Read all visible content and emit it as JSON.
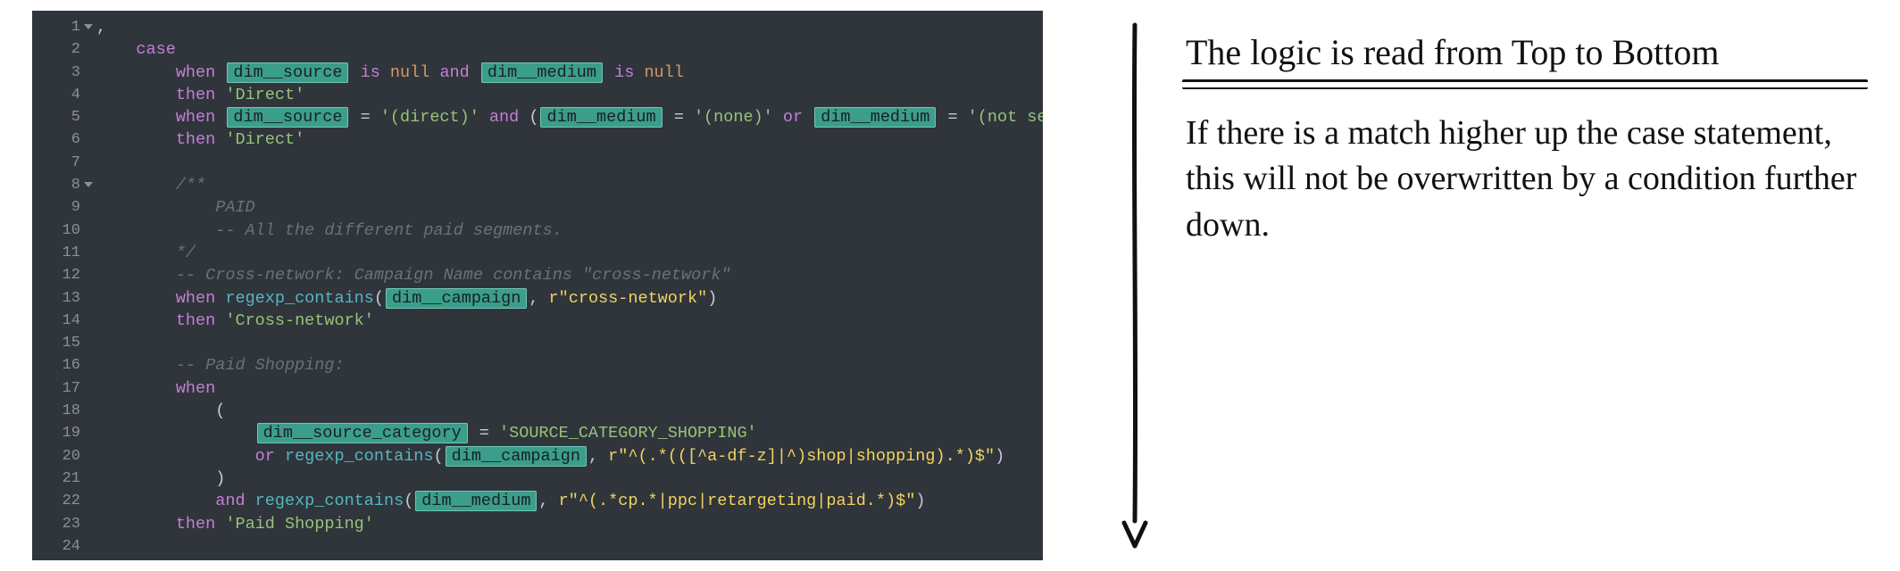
{
  "annotation": {
    "heading": "The logic is read from Top to Bottom",
    "body": "If there is a match higher up the case statement, this will not be overwritten by a condition further down."
  },
  "code": {
    "lines": [
      {
        "n": 1,
        "fold": true,
        "indent": 0,
        "tokens": [
          {
            "t": ",",
            "c": "punc"
          }
        ]
      },
      {
        "n": 2,
        "fold": false,
        "indent": 4,
        "tokens": [
          {
            "t": "case",
            "c": "kw"
          }
        ]
      },
      {
        "n": 3,
        "fold": false,
        "indent": 8,
        "tokens": [
          {
            "t": "when",
            "c": "kw"
          },
          {
            "t": " "
          },
          {
            "t": "dim__source",
            "c": "chip"
          },
          {
            "t": " "
          },
          {
            "t": "is",
            "c": "kw"
          },
          {
            "t": " "
          },
          {
            "t": "null",
            "c": "null"
          },
          {
            "t": " "
          },
          {
            "t": "and",
            "c": "kw"
          },
          {
            "t": " "
          },
          {
            "t": "dim__medium",
            "c": "chip"
          },
          {
            "t": " "
          },
          {
            "t": "is",
            "c": "kw"
          },
          {
            "t": " "
          },
          {
            "t": "null",
            "c": "null"
          }
        ]
      },
      {
        "n": 4,
        "fold": false,
        "indent": 8,
        "tokens": [
          {
            "t": "then",
            "c": "kw"
          },
          {
            "t": " "
          },
          {
            "t": "'Direct'",
            "c": "str"
          }
        ]
      },
      {
        "n": 5,
        "fold": false,
        "indent": 8,
        "tokens": [
          {
            "t": "when",
            "c": "kw"
          },
          {
            "t": " "
          },
          {
            "t": "dim__source",
            "c": "chip"
          },
          {
            "t": " "
          },
          {
            "t": "=",
            "c": "punc"
          },
          {
            "t": " "
          },
          {
            "t": "'(direct)'",
            "c": "str"
          },
          {
            "t": " "
          },
          {
            "t": "and",
            "c": "kw"
          },
          {
            "t": " "
          },
          {
            "t": "(",
            "c": "punc"
          },
          {
            "t": "dim__medium",
            "c": "chip"
          },
          {
            "t": " "
          },
          {
            "t": "=",
            "c": "punc"
          },
          {
            "t": " "
          },
          {
            "t": "'(none)'",
            "c": "str"
          },
          {
            "t": " "
          },
          {
            "t": "or",
            "c": "kw"
          },
          {
            "t": " "
          },
          {
            "t": "dim__medium",
            "c": "chip"
          },
          {
            "t": " "
          },
          {
            "t": "=",
            "c": "punc"
          },
          {
            "t": " "
          },
          {
            "t": "'(not set)'",
            "c": "str"
          },
          {
            "t": ")",
            "c": "punc"
          }
        ]
      },
      {
        "n": 6,
        "fold": false,
        "indent": 8,
        "tokens": [
          {
            "t": "then",
            "c": "kw"
          },
          {
            "t": " "
          },
          {
            "t": "'Direct'",
            "c": "str"
          }
        ]
      },
      {
        "n": 7,
        "fold": false,
        "indent": 0,
        "tokens": []
      },
      {
        "n": 8,
        "fold": true,
        "indent": 8,
        "tokens": [
          {
            "t": "/**",
            "c": "cmt"
          }
        ]
      },
      {
        "n": 9,
        "fold": false,
        "indent": 12,
        "tokens": [
          {
            "t": "PAID",
            "c": "cmt"
          }
        ]
      },
      {
        "n": 10,
        "fold": false,
        "indent": 12,
        "tokens": [
          {
            "t": "-- All the different paid segments.",
            "c": "cmt"
          }
        ]
      },
      {
        "n": 11,
        "fold": false,
        "indent": 8,
        "tokens": [
          {
            "t": "*/",
            "c": "cmt"
          }
        ]
      },
      {
        "n": 12,
        "fold": false,
        "indent": 8,
        "tokens": [
          {
            "t": "-- Cross-network: Campaign Name contains \"cross-network\"",
            "c": "cmt"
          }
        ]
      },
      {
        "n": 13,
        "fold": false,
        "indent": 8,
        "tokens": [
          {
            "t": "when",
            "c": "kw"
          },
          {
            "t": " "
          },
          {
            "t": "regexp_contains",
            "c": "func"
          },
          {
            "t": "(",
            "c": "punc"
          },
          {
            "t": "dim__campaign",
            "c": "chip"
          },
          {
            "t": ", ",
            "c": "punc"
          },
          {
            "t": "r\"cross-network\"",
            "c": "str2"
          },
          {
            "t": ")",
            "c": "punc"
          }
        ]
      },
      {
        "n": 14,
        "fold": false,
        "indent": 8,
        "tokens": [
          {
            "t": "then",
            "c": "kw"
          },
          {
            "t": " "
          },
          {
            "t": "'Cross-network'",
            "c": "str"
          }
        ]
      },
      {
        "n": 15,
        "fold": false,
        "indent": 0,
        "tokens": []
      },
      {
        "n": 16,
        "fold": false,
        "indent": 8,
        "tokens": [
          {
            "t": "-- Paid Shopping:",
            "c": "cmt"
          }
        ]
      },
      {
        "n": 17,
        "fold": false,
        "indent": 8,
        "tokens": [
          {
            "t": "when",
            "c": "kw"
          }
        ]
      },
      {
        "n": 18,
        "fold": false,
        "indent": 12,
        "tokens": [
          {
            "t": "(",
            "c": "punc"
          }
        ]
      },
      {
        "n": 19,
        "fold": false,
        "indent": 16,
        "tokens": [
          {
            "t": "dim__source_category",
            "c": "chip"
          },
          {
            "t": " "
          },
          {
            "t": "=",
            "c": "punc"
          },
          {
            "t": " "
          },
          {
            "t": "'SOURCE_CATEGORY_SHOPPING'",
            "c": "str"
          }
        ]
      },
      {
        "n": 20,
        "fold": false,
        "indent": 16,
        "tokens": [
          {
            "t": "or",
            "c": "kw"
          },
          {
            "t": " "
          },
          {
            "t": "regexp_contains",
            "c": "func"
          },
          {
            "t": "(",
            "c": "punc"
          },
          {
            "t": "dim__campaign",
            "c": "chip"
          },
          {
            "t": ", ",
            "c": "punc"
          },
          {
            "t": "r\"^(.*(([^a-df-z]|^)shop|shopping).*)$\"",
            "c": "str2"
          },
          {
            "t": ")",
            "c": "punc"
          }
        ]
      },
      {
        "n": 21,
        "fold": false,
        "indent": 12,
        "tokens": [
          {
            "t": ")",
            "c": "punc"
          }
        ]
      },
      {
        "n": 22,
        "fold": false,
        "indent": 12,
        "tokens": [
          {
            "t": "and",
            "c": "kw"
          },
          {
            "t": " "
          },
          {
            "t": "regexp_contains",
            "c": "func"
          },
          {
            "t": "(",
            "c": "punc"
          },
          {
            "t": "dim__medium",
            "c": "chip"
          },
          {
            "t": ", ",
            "c": "punc"
          },
          {
            "t": "r\"^(.*cp.*|ppc|retargeting|paid.*)$\"",
            "c": "str2"
          },
          {
            "t": ")",
            "c": "punc"
          }
        ]
      },
      {
        "n": 23,
        "fold": false,
        "indent": 8,
        "tokens": [
          {
            "t": "then",
            "c": "kw"
          },
          {
            "t": " "
          },
          {
            "t": "'Paid Shopping'",
            "c": "str"
          }
        ]
      },
      {
        "n": 24,
        "fold": false,
        "indent": 0,
        "tokens": []
      }
    ]
  }
}
